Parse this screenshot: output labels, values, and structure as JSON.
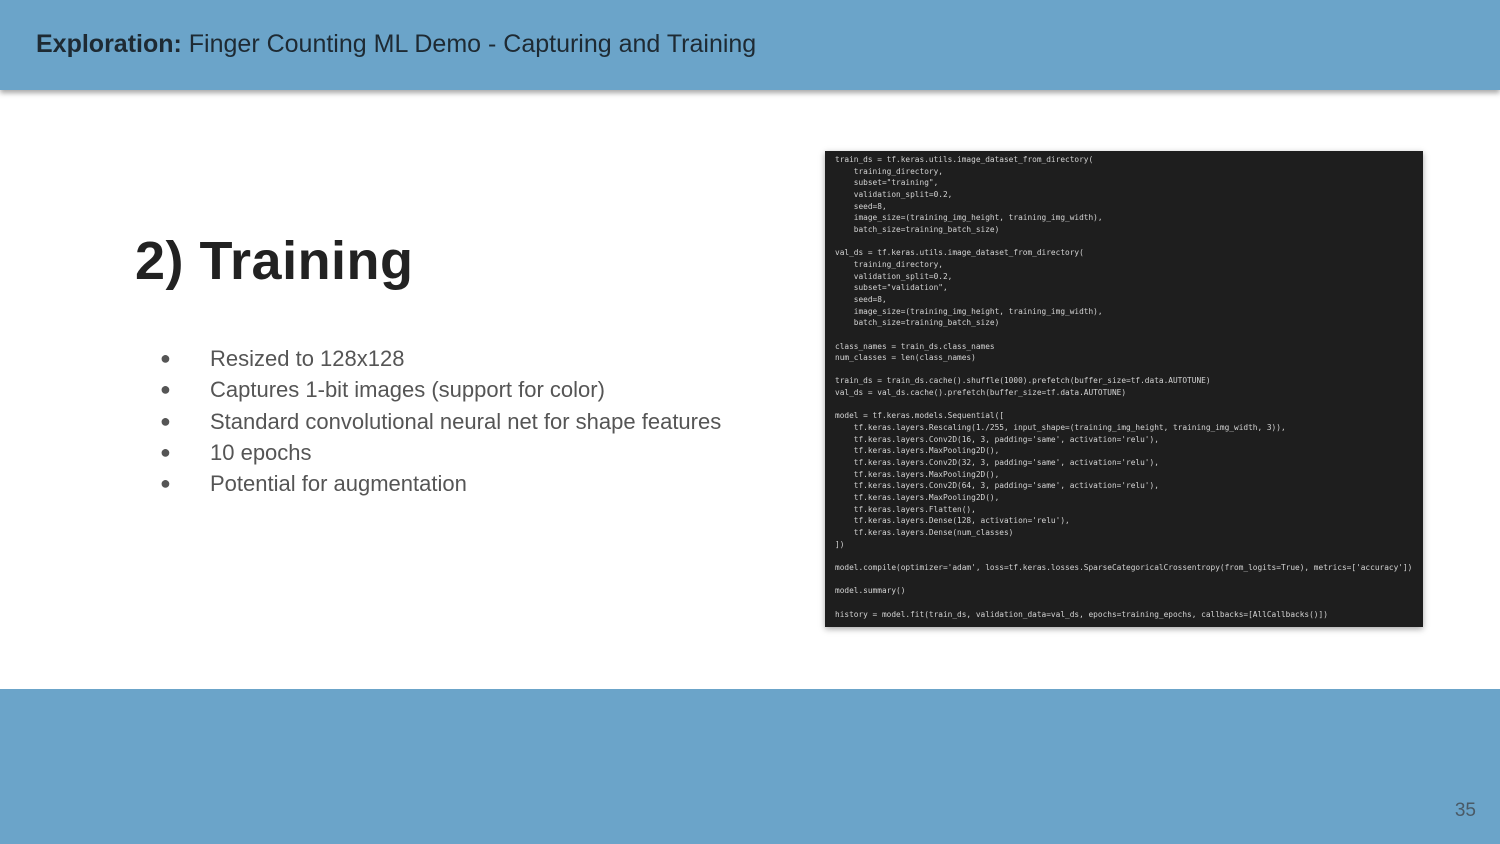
{
  "header": {
    "bold_label": "Exploration:",
    "title": " Finger Counting ML Demo - Capturing and Training"
  },
  "slide": {
    "title": "2) Training",
    "bullet_glyph": "●",
    "bullets": [
      "Resized to 128x128",
      "Captures 1-bit images (support for color)",
      "Standard convolutional neural net for shape features",
      "10 epochs",
      "Potential for augmentation"
    ]
  },
  "code_screenshot": {
    "background": "#1e1e1e",
    "text": "train_ds = tf.keras.utils.image_dataset_from_directory(\n    training_directory,\n    subset=\"training\",\n    validation_split=0.2,\n    seed=8,\n    image_size=(training_img_height, training_img_width),\n    batch_size=training_batch_size)\n\nval_ds = tf.keras.utils.image_dataset_from_directory(\n    training_directory,\n    validation_split=0.2,\n    subset=\"validation\",\n    seed=8,\n    image_size=(training_img_height, training_img_width),\n    batch_size=training_batch_size)\n\nclass_names = train_ds.class_names\nnum_classes = len(class_names)\n\ntrain_ds = train_ds.cache().shuffle(1000).prefetch(buffer_size=tf.data.AUTOTUNE)\nval_ds = val_ds.cache().prefetch(buffer_size=tf.data.AUTOTUNE)\n\nmodel = tf.keras.models.Sequential([\n    tf.keras.layers.Rescaling(1./255, input_shape=(training_img_height, training_img_width, 3)),\n    tf.keras.layers.Conv2D(16, 3, padding='same', activation='relu'),\n    tf.keras.layers.MaxPooling2D(),\n    tf.keras.layers.Conv2D(32, 3, padding='same', activation='relu'),\n    tf.keras.layers.MaxPooling2D(),\n    tf.keras.layers.Conv2D(64, 3, padding='same', activation='relu'),\n    tf.keras.layers.MaxPooling2D(),\n    tf.keras.layers.Flatten(),\n    tf.keras.layers.Dense(128, activation='relu'),\n    tf.keras.layers.Dense(num_classes)\n])\n\nmodel.compile(optimizer='adam', loss=tf.keras.losses.SparseCategoricalCrossentropy(from_logits=True), metrics=['accuracy'])\n\nmodel.summary()\n\nhistory = model.fit(train_ds, validation_data=val_ds, epochs=training_epochs, callbacks=[AllCallbacks()])"
  },
  "footer": {
    "page_number": "35"
  },
  "colors": {
    "header_band": "#6ba4c9",
    "footer_band": "#6ba4c9",
    "title_text": "#222222",
    "bullet_text": "#555555"
  }
}
